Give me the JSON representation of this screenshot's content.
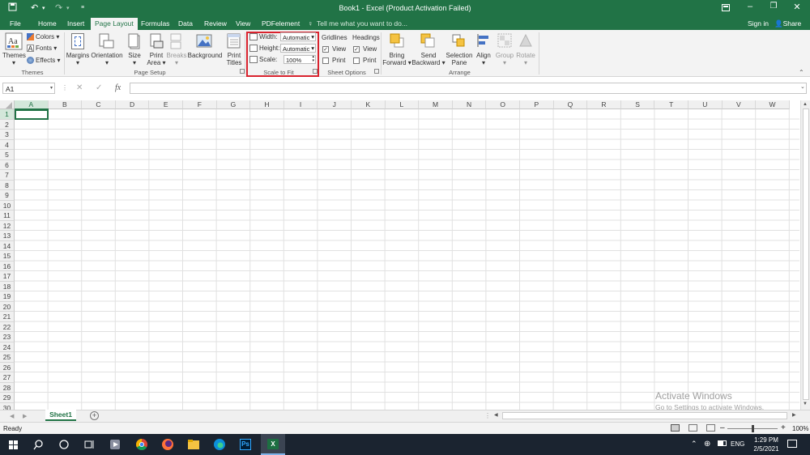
{
  "window": {
    "title": "Book1 - Excel (Product Activation Failed)",
    "quick_access": [
      "save-icon",
      "undo-icon",
      "redo-icon",
      "customize-icon"
    ],
    "controls": [
      "ribbon-display-icon",
      "minimize-icon",
      "restore-icon",
      "close-icon"
    ]
  },
  "tabs": {
    "items": [
      "File",
      "Home",
      "Insert",
      "Page Layout",
      "Formulas",
      "Data",
      "Review",
      "View",
      "PDFelement"
    ],
    "active": "Page Layout",
    "tell_me": "Tell me what you want to do...",
    "sign_in": "Sign in",
    "share": "Share"
  },
  "ribbon": {
    "themes": {
      "label": "Themes",
      "colors": "Colors",
      "fonts": "Fonts",
      "effects": "Effects",
      "group": "Themes"
    },
    "page_setup": {
      "margins": "Margins",
      "orientation": "Orientation",
      "size": "Size",
      "print_area_1": "Print",
      "print_area_2": "Area",
      "breaks": "Breaks",
      "background": "Background",
      "print_titles_1": "Print",
      "print_titles_2": "Titles",
      "group": "Page Setup"
    },
    "scale_to_fit": {
      "width_label": "Width:",
      "width_value": "Automatic",
      "height_label": "Height:",
      "height_value": "Automatic",
      "scale_label": "Scale:",
      "scale_value": "100%",
      "group": "Scale to Fit",
      "highlight_color": "#d9232e"
    },
    "sheet_options": {
      "gridlines": "Gridlines",
      "headings": "Headings",
      "view": "View",
      "print": "Print",
      "gridlines_view": true,
      "gridlines_print": false,
      "headings_view": true,
      "headings_print": false,
      "group": "Sheet Options"
    },
    "arrange": {
      "bring_1": "Bring",
      "bring_2": "Forward",
      "send_1": "Send",
      "send_2": "Backward",
      "selection_1": "Selection",
      "selection_2": "Pane",
      "align": "Align",
      "group_btn": "Group",
      "rotate": "Rotate",
      "group": "Arrange"
    }
  },
  "formula_bar": {
    "name_box": "A1",
    "cancel": "✕",
    "enter": "✓",
    "fx": "fx",
    "value": ""
  },
  "grid": {
    "columns": [
      "A",
      "B",
      "C",
      "D",
      "E",
      "F",
      "G",
      "H",
      "I",
      "J",
      "K",
      "L",
      "M",
      "N",
      "O",
      "P",
      "Q",
      "R",
      "S",
      "T",
      "U",
      "V",
      "W"
    ],
    "rows": [
      "1",
      "2",
      "3",
      "4",
      "5",
      "6",
      "7",
      "8",
      "9",
      "10",
      "11",
      "12",
      "13",
      "14",
      "15",
      "16",
      "17",
      "18",
      "19",
      "20",
      "21",
      "22",
      "23",
      "24",
      "25",
      "26",
      "27",
      "28",
      "29",
      "30"
    ],
    "selected_cell": "A1"
  },
  "sheets": {
    "tabs": [
      "Sheet1"
    ],
    "active": "Sheet1"
  },
  "status": {
    "text": "Ready",
    "zoom": "100%"
  },
  "watermark": {
    "line1": "Activate Windows",
    "line2": "Go to Settings to activate Windows."
  },
  "taskbar": {
    "tray_lang": "ENG",
    "time": "1:29 PM",
    "date": "2/5/2021",
    "ps_label": "Ps"
  },
  "colors": {
    "excel_green": "#217346",
    "taskbar": "#1b2430"
  }
}
